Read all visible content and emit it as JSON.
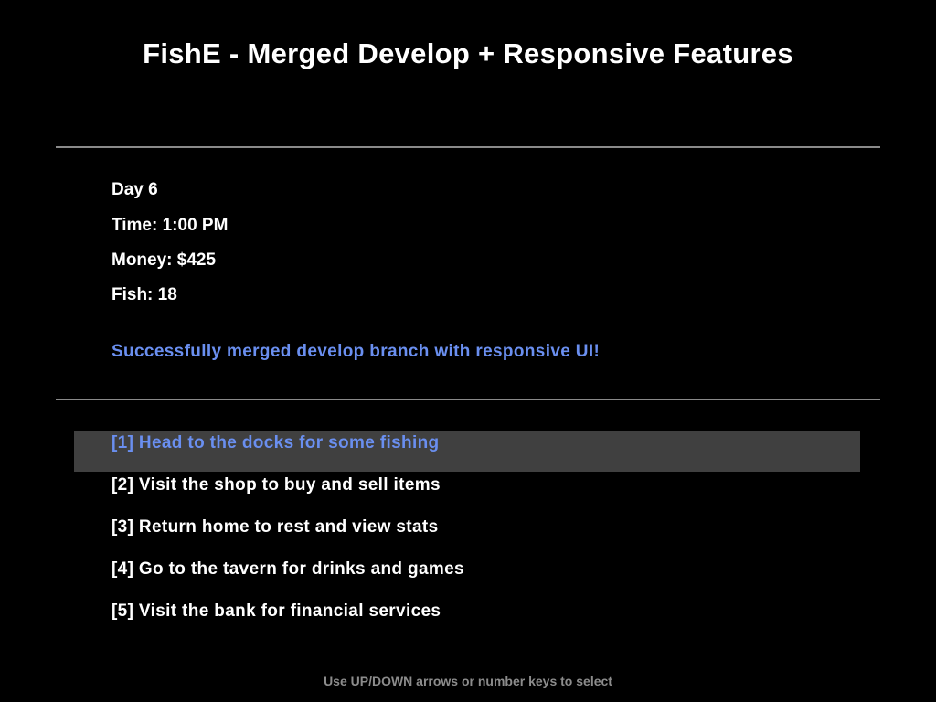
{
  "title": "FishE - Merged Develop + Responsive Features",
  "colors": {
    "background": "#000000",
    "text": "#ffffff",
    "accent": "#6a8ff0",
    "divider": "#8a8a8a",
    "selection_background": "#404040",
    "hint": "#8c8c8c"
  },
  "stats": {
    "day": "Day 6",
    "time": "Time: 1:00 PM",
    "money": "Money: $425",
    "fish": "Fish: 18"
  },
  "message": "Successfully merged develop branch with responsive UI!",
  "menu": {
    "selected_index": 0,
    "items": [
      {
        "label": "[1] Head to the docks for some fishing"
      },
      {
        "label": "[2] Visit the shop to buy and sell items"
      },
      {
        "label": "[3] Return home to rest and view stats"
      },
      {
        "label": "[4] Go to the tavern for drinks and games"
      },
      {
        "label": "[5] Visit the bank for financial services"
      }
    ]
  },
  "hint": "Use UP/DOWN arrows or number keys to select"
}
